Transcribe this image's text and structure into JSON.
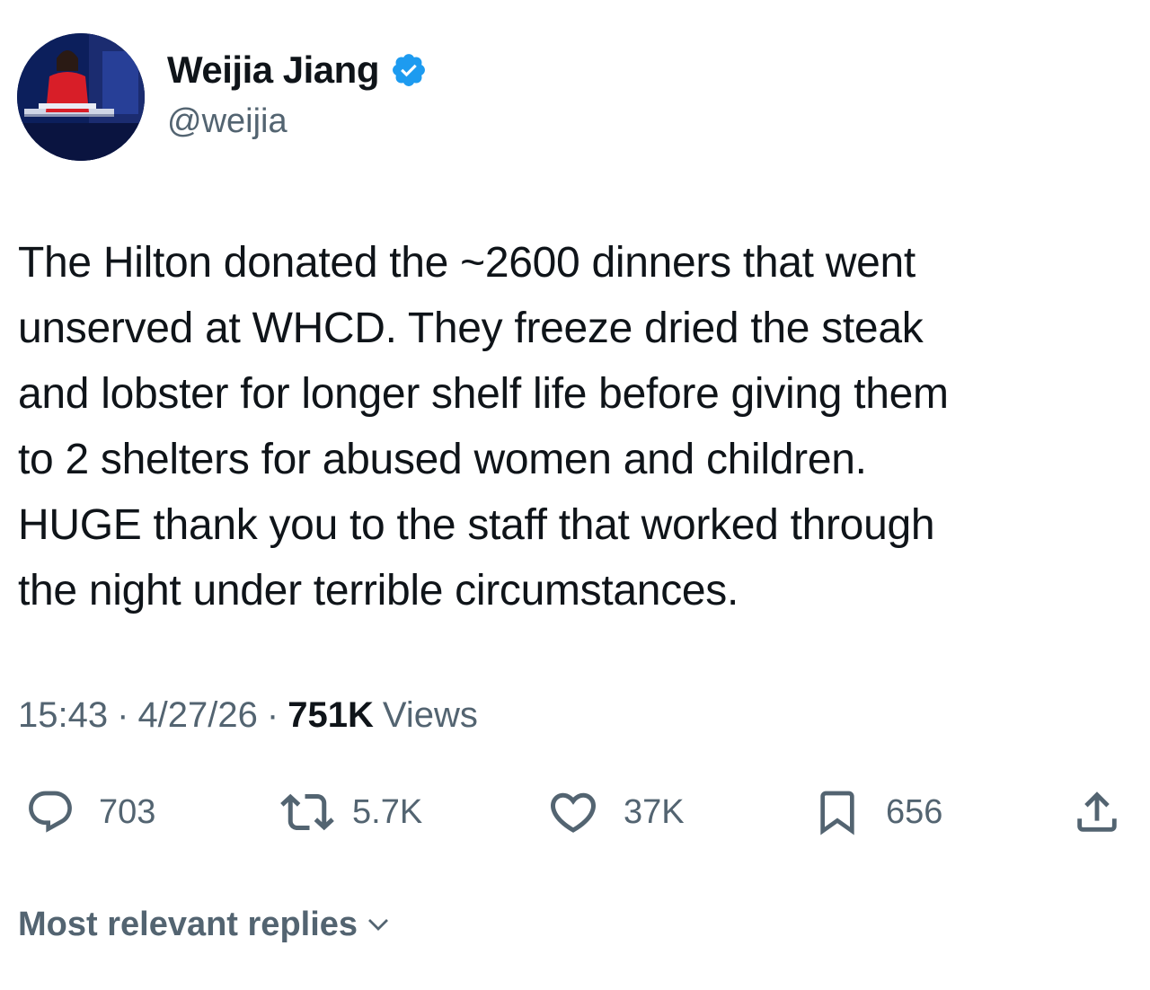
{
  "author": {
    "display_name": "Weijia Jiang",
    "handle": "@weijia",
    "avatar_icon": "profile-photo",
    "verified_icon": "verified-badge-icon",
    "verified_color": "#1d9bf0"
  },
  "tweet": {
    "text": "The Hilton donated the ~2600 dinners that went\nunserved at WHCD. They freeze dried the steak\nand lobster for longer shelf life before giving them\nto 2 shelters for abused women and children.\nHUGE thank you to the staff that worked through\nthe night under terrible circumstances.",
    "time": "15:43",
    "date": "4/27/26",
    "separator": "·",
    "views_count": "751K",
    "views_label": "Views"
  },
  "actions": {
    "reply": {
      "icon": "reply-icon",
      "count": "703"
    },
    "retweet": {
      "icon": "retweet-icon",
      "count": "5.7K"
    },
    "like": {
      "icon": "heart-icon",
      "count": "37K"
    },
    "bookmark": {
      "icon": "bookmark-icon",
      "count": "656"
    },
    "share": {
      "icon": "share-icon"
    }
  },
  "replies": {
    "label": "Most relevant replies",
    "icon": "chevron-down-icon"
  },
  "colors": {
    "text_primary": "#0f1419",
    "text_secondary": "#536471",
    "accent": "#1d9bf0"
  }
}
